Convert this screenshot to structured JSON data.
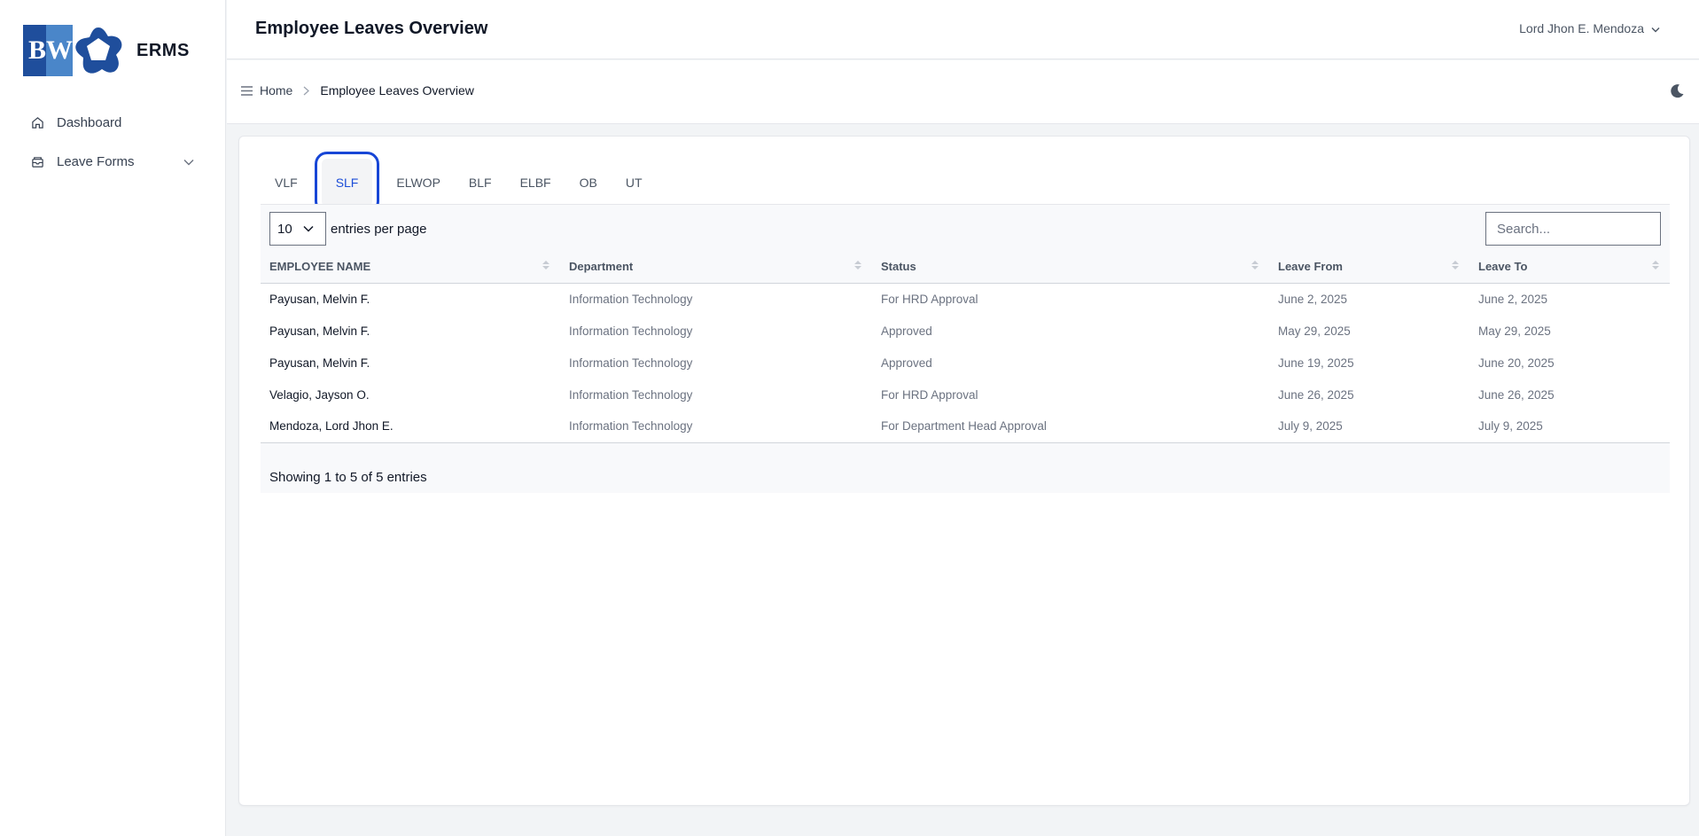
{
  "brand": {
    "logo_text_b": "B",
    "logo_text_w": "W",
    "name": "ERMS"
  },
  "sidebar": {
    "items": [
      {
        "label": "Dashboard",
        "icon": "home-icon"
      },
      {
        "label": "Leave Forms",
        "icon": "inbox-icon"
      }
    ]
  },
  "header": {
    "title": "Employee Leaves Overview",
    "user": "Lord Jhon E. Mendoza"
  },
  "breadcrumb": {
    "home": "Home",
    "current": "Employee Leaves Overview"
  },
  "tabs": [
    {
      "label": "VLF",
      "active": false
    },
    {
      "label": "SLF",
      "active": true
    },
    {
      "label": "ELWOP",
      "active": false
    },
    {
      "label": "BLF",
      "active": false
    },
    {
      "label": "ELBF",
      "active": false
    },
    {
      "label": "OB",
      "active": false
    },
    {
      "label": "UT",
      "active": false
    }
  ],
  "table_controls": {
    "per_page_value": "10",
    "per_page_label": "entries per page",
    "search_placeholder": "Search..."
  },
  "table": {
    "columns": [
      "EMPLOYEE NAME",
      "Department",
      "Status",
      "Leave From",
      "Leave To"
    ],
    "rows": [
      [
        "Payusan, Melvin F.",
        "Information Technology",
        "For HRD Approval",
        "June 2, 2025",
        "June 2, 2025"
      ],
      [
        "Payusan, Melvin F.",
        "Information Technology",
        "Approved",
        "May 29, 2025",
        "May 29, 2025"
      ],
      [
        "Payusan, Melvin F.",
        "Information Technology",
        "Approved",
        "June 19, 2025",
        "June 20, 2025"
      ],
      [
        "Velagio, Jayson O.",
        "Information Technology",
        "For HRD Approval",
        "June 26, 2025",
        "June 26, 2025"
      ],
      [
        "Mendoza, Lord Jhon E.",
        "Information Technology",
        "For Department Head Approval",
        "July 9, 2025",
        "July 9, 2025"
      ]
    ],
    "info": "Showing 1 to 5 of 5 entries"
  },
  "colors": {
    "accent": "#1746d6",
    "brand_dark": "#1f4e9c",
    "brand_light": "#4a86c9"
  }
}
